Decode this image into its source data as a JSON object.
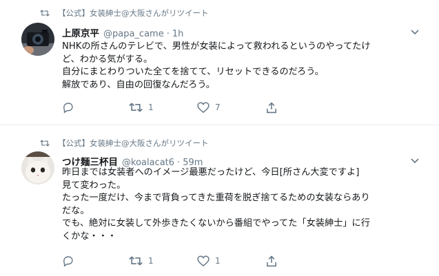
{
  "tweets": [
    {
      "retweet_by": "【公式】女装紳士@大阪さんがリツイート",
      "name": "上原京平",
      "handle": "@papa_came",
      "sep": "·",
      "time": "1h",
      "lines": [
        "NHKの所さんのテレビで、男性が女装によって救われるというのやってたけ",
        "ど、わかる気がする。",
        "自分にまとわりついた全てを捨てて、リセットできるのだろう。",
        "解放であり、自由の回復なんだろう。"
      ],
      "retweets": "1",
      "likes": "7"
    },
    {
      "retweet_by": "【公式】女装紳士@大阪さんがリツイート",
      "name": "つけ麺三杯目",
      "handle": "@koalacat6",
      "sep": "·",
      "time": "59m",
      "lines": [
        "昨日までは女装者へのイメージ最悪だったけど、今日[所さん大変ですよ]",
        "見て変わった。",
        "たった一度だけ、今まで背負ってきた重荷を脱ぎ捨てるための女装ならあり",
        "だな。",
        "でも、絶対に女装して外歩きたくないから番組でやってた「女装紳士」に行",
        "くかな・・・"
      ],
      "retweets": "1",
      "likes": "1"
    }
  ],
  "icons": [
    "retweet-icon",
    "reply-icon",
    "heart-icon",
    "share-icon",
    "chevron-down-icon"
  ],
  "colors": {
    "text": "#14171a",
    "secondary": "#657786",
    "divider": "#e6ecf0"
  }
}
